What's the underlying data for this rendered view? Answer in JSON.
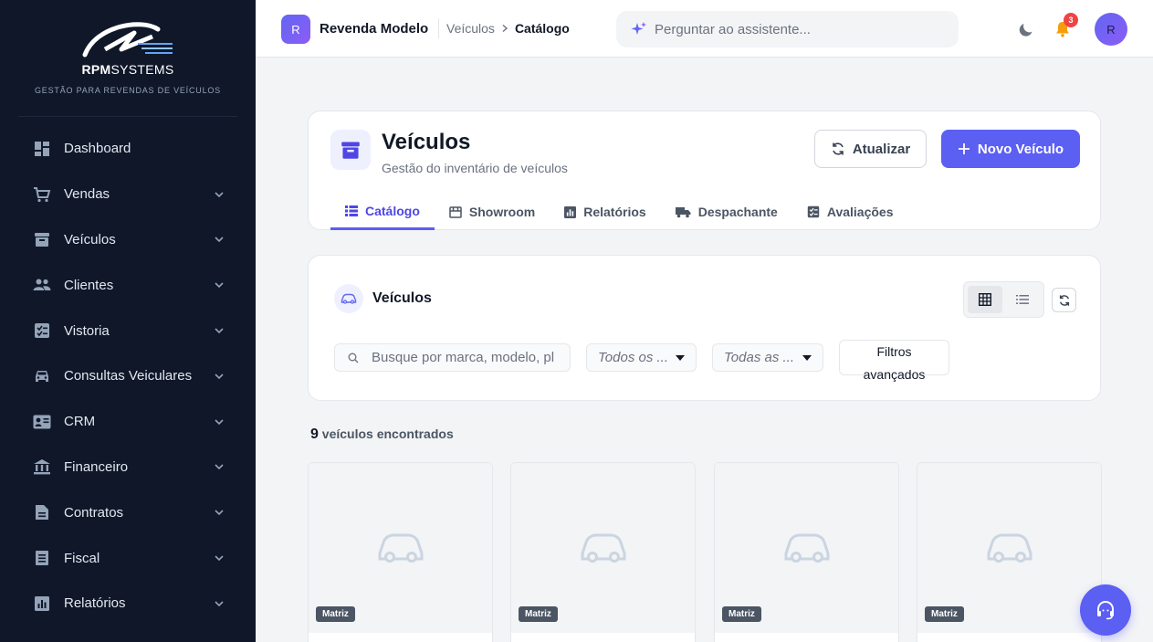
{
  "brand": {
    "name_bold": "RPM",
    "name_rest": "SYSTEMS",
    "tagline": "GESTÃO PARA REVENDAS DE VEÍCULOS"
  },
  "sidebar": {
    "items": [
      {
        "label": "Dashboard",
        "icon": "dashboard-icon",
        "has_children": false
      },
      {
        "label": "Vendas",
        "icon": "cart-icon",
        "has_children": true
      },
      {
        "label": "Veículos",
        "icon": "archive-icon",
        "has_children": true
      },
      {
        "label": "Clientes",
        "icon": "people-icon",
        "has_children": true
      },
      {
        "label": "Vistoria",
        "icon": "checklist-icon",
        "has_children": true
      },
      {
        "label": "Consultas Veiculares",
        "icon": "car-icon",
        "has_children": true
      },
      {
        "label": "CRM",
        "icon": "contact-card-icon",
        "has_children": true
      },
      {
        "label": "Financeiro",
        "icon": "bank-icon",
        "has_children": true
      },
      {
        "label": "Contratos",
        "icon": "document-icon",
        "has_children": true
      },
      {
        "label": "Fiscal",
        "icon": "receipt-icon",
        "has_children": true
      },
      {
        "label": "Relatórios",
        "icon": "bar-chart-icon",
        "has_children": true
      }
    ]
  },
  "topbar": {
    "org_initial": "R",
    "org_name": "Revenda Modelo",
    "breadcrumb": [
      "Veículos",
      "Catálogo"
    ],
    "assistant_placeholder": "Perguntar ao assistente...",
    "notification_count": "3",
    "user_initial": "R"
  },
  "header": {
    "title": "Veículos",
    "subtitle": "Gestão do inventário de veículos",
    "refresh_label": "Atualizar",
    "new_label": "Novo Veículo",
    "tabs": [
      {
        "label": "Catálogo",
        "active": true
      },
      {
        "label": "Showroom",
        "active": false
      },
      {
        "label": "Relatórios",
        "active": false
      },
      {
        "label": "Despachante",
        "active": false
      },
      {
        "label": "Avaliações",
        "active": false
      }
    ]
  },
  "filters": {
    "title": "Veículos",
    "search_placeholder": "Busque por marca, modelo, placa...",
    "select1": "Todos os ...",
    "select2": "Todas as ...",
    "advanced_line1": "Filtros",
    "advanced_line2": "avançados"
  },
  "results": {
    "count": "9",
    "label": "veículos encontrados"
  },
  "vehicles": [
    {
      "badge": "Matriz"
    },
    {
      "badge": "Matriz"
    },
    {
      "badge": "Matriz"
    },
    {
      "badge": "Matriz"
    }
  ],
  "colors": {
    "sidebar_bg": "#0f1729",
    "accent": "#5b5ff2",
    "page_bg": "#f3f4f6",
    "badge_red": "#ef4444"
  }
}
